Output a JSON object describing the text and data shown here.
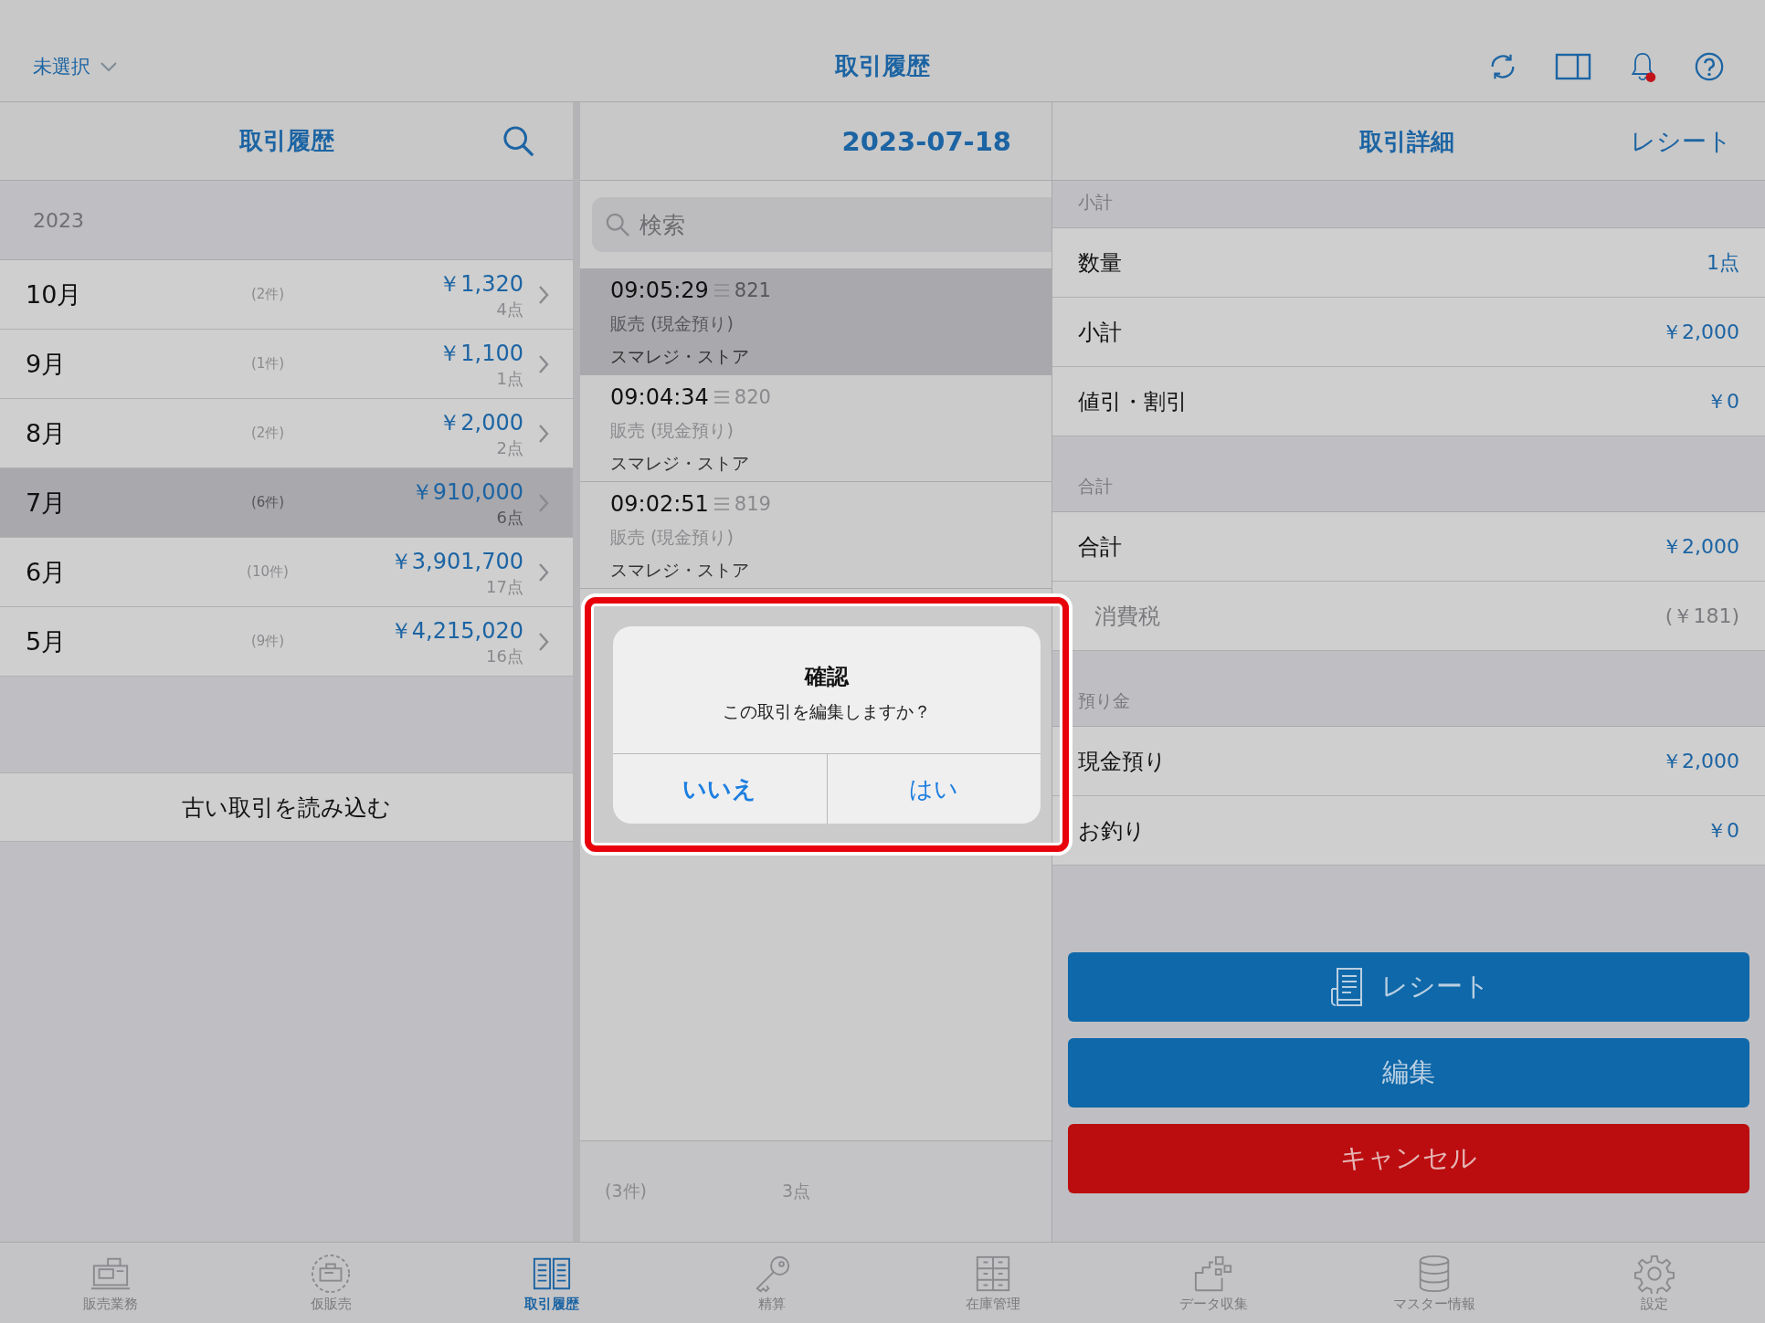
{
  "top_bar": {
    "store_selector": "未選択",
    "title": "取引履歴"
  },
  "months_panel": {
    "title": "取引履歴",
    "year": "2023",
    "months": [
      {
        "month": "10月",
        "count": "(2件)",
        "amount": "￥1,320",
        "points": "4点",
        "selected": false
      },
      {
        "month": "9月",
        "count": "(1件)",
        "amount": "￥1,100",
        "points": "1点",
        "selected": false
      },
      {
        "month": "8月",
        "count": "(2件)",
        "amount": "￥2,000",
        "points": "2点",
        "selected": false
      },
      {
        "month": "7月",
        "count": "(6件)",
        "amount": "￥910,000",
        "points": "6点",
        "selected": true
      },
      {
        "month": "6月",
        "count": "(10件)",
        "amount": "￥3,901,700",
        "points": "17点",
        "selected": false
      },
      {
        "month": "5月",
        "count": "(9件)",
        "amount": "￥4,215,020",
        "points": "16点",
        "selected": false
      }
    ],
    "load_older_button": "古い取引を読み込む"
  },
  "transactions_panel": {
    "date": "2023-07-18",
    "search": {
      "placeholder": "検索"
    },
    "transactions": [
      {
        "time": "09:05:29",
        "number": "821",
        "type": "販売 (現金預り)",
        "store": "スマレジ・ストア",
        "selected": true
      },
      {
        "time": "09:04:34",
        "number": "820",
        "type": "販売 (現金預り)",
        "store": "スマレジ・ストア",
        "selected": false
      },
      {
        "time": "09:02:51",
        "number": "819",
        "type": "販売 (現金預り)",
        "store": "スマレジ・ストア",
        "selected": false
      }
    ],
    "footer": {
      "count": "(3件)",
      "points": "3点"
    }
  },
  "detail_panel": {
    "title": "取引詳細",
    "receipt_link": "レシート",
    "sections": [
      {
        "header": "小計",
        "rows": [
          {
            "label": "数量",
            "value": "1点",
            "kind": "main"
          },
          {
            "label": "小計",
            "value": "￥2,000",
            "kind": "main"
          },
          {
            "label": "値引・割引",
            "value": "￥0",
            "kind": "main"
          }
        ]
      },
      {
        "header": "合計",
        "rows": [
          {
            "label": "合計",
            "value": "￥2,000",
            "kind": "main"
          },
          {
            "label": "消費税",
            "value": "(￥181)",
            "kind": "sub"
          }
        ]
      },
      {
        "header": "預り金",
        "rows": [
          {
            "label": "現金預り",
            "value": "￥2,000",
            "kind": "main"
          },
          {
            "label": "お釣り",
            "value": "￥0",
            "kind": "main"
          }
        ]
      }
    ],
    "buttons": [
      {
        "label": "レシート",
        "kind": "receipt"
      },
      {
        "label": "編集",
        "kind": "primary"
      },
      {
        "label": "キャンセル",
        "kind": "danger"
      }
    ]
  },
  "dialog": {
    "title": "確認",
    "message": "この取引を編集しますか？",
    "buttons": [
      {
        "label": "いいえ",
        "bold": true
      },
      {
        "label": "はい",
        "bold": false
      }
    ]
  },
  "tab_bar": [
    {
      "label": "販売業務",
      "selected": false
    },
    {
      "label": "仮販売",
      "selected": false
    },
    {
      "label": "取引履歴",
      "selected": true
    },
    {
      "label": "精算",
      "selected": false
    },
    {
      "label": "在庫管理",
      "selected": false
    },
    {
      "label": "データ収集",
      "selected": false
    },
    {
      "label": "マスター情報",
      "selected": false
    },
    {
      "label": "設定",
      "selected": false
    }
  ]
}
